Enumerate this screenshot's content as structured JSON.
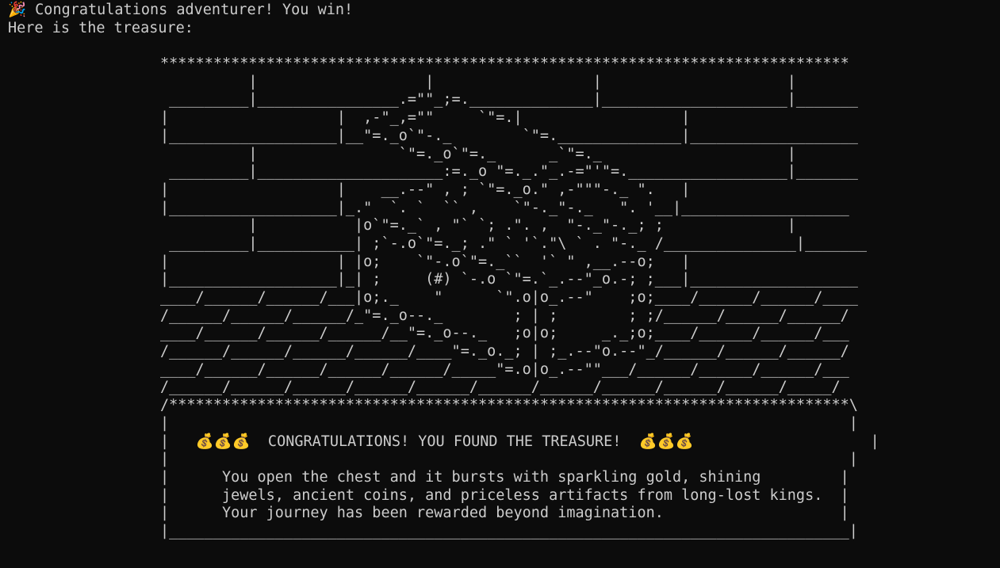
{
  "terminal": {
    "win_line": "🎉 Congratulations adventurer! You win!",
    "intro_line": "Here is the treasure:",
    "blank_line": "",
    "art_lines": [
      "******************************************************************************",
      "          |                   |                  |                     |",
      " _________|________________.=\"\"_;=.______________|_____________________|_______",
      "|                   |  ,-\"_,=\"\"     `\"=.|                  |",
      "|___________________|__\"=._o`\"-._        `\"=.______________|___________________",
      "          |                `\"=._o`\"=._      _`\"=._                     |",
      " _________|_____________________:=._o \"=._.\"_.-=\"'\"=.__________________|_______",
      "|                   |    __.--\" , ; `\"=._o.\" ,-\"\"\"-._ \".   |",
      "|___________________|_.\"  `. `  `` ,    `\"-._\"-._   \". '__|___________________",
      "          |           |o`\"=._` , \"` `; .\". ,  \"-._\"-._; ;              |",
      " _________|___________| ;`-.o`\"=._; .\" ` '`.\"\\ ` . \"-._ /_______________|_______",
      "|                   | |o;    `\"-.o`\"=._``  '` \" ,__.--o;   |",
      "|___________________|_| ;     (#) `-.o `\"=.`_.--\"_o.-; ;___|___________________",
      "____/______/______/___|o;._    \"      `\".o|o_.--\"    ;o;____/______/______/____",
      "/______/______/______/_\"=._o--._        ; | ;        ; ;/______/______/______/",
      "____/______/______/______/__\"=._o--._   ;o|o;     _._;o;____/______/______/___",
      "/______/______/______/______/____\"=._o._; | ;_.--\"o.--\"_/______/______/______/",
      "____/______/______/______/______/_____\"=.o|o_.--\"\"___/______/______/______/___",
      "/______/______/______/______/______/______/______/______/______/______/_____/",
      "/*****************************************************************************\\",
      "|                                                                             |",
      "|   💰💰💰  CONGRATULATIONS! YOU FOUND THE TREASURE!  💰💰💰                    |",
      "|                                                                             |",
      "|      You open the chest and it bursts with sparkling gold, shining         |",
      "|      jewels, ancient coins, and priceless artifacts from long-lost kings.  |",
      "|      Your journey has been rewarded beyond imagination.                    |",
      "|_____________________________________________________________________________|"
    ]
  }
}
